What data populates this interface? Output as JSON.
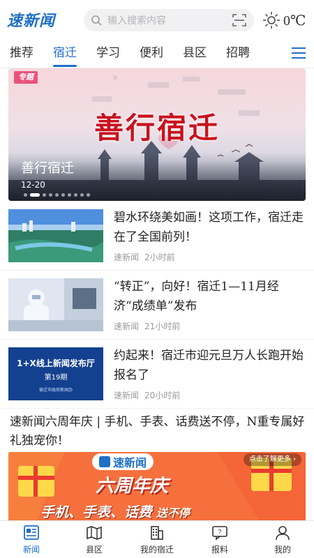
{
  "header": {
    "logo_text": "速新闻",
    "search_placeholder": "输入搜索内容",
    "temperature": "0℃",
    "icons": [
      "search-icon",
      "scan-icon",
      "sun-icon"
    ]
  },
  "tabs": [
    {
      "label": "推荐",
      "active": false
    },
    {
      "label": "宿迁",
      "active": true
    },
    {
      "label": "学习",
      "active": false
    },
    {
      "label": "便利",
      "active": false
    },
    {
      "label": "县区",
      "active": false
    },
    {
      "label": "招聘",
      "active": false
    }
  ],
  "banner": {
    "tag": "专题",
    "headline": "善行宿迁",
    "caption": "善行宿迁",
    "date": "12-20",
    "dots_total": 10,
    "dots_active": 1
  },
  "news": [
    {
      "title": "碧水环绕美如画！这项工作，宿迁走在了全国前列！",
      "source": "速新闻",
      "time": "2小时前"
    },
    {
      "title": "“转正”，向好！宿迁1—11月经济“成绩单”发布",
      "source": "速新闻",
      "time": "21小时前"
    },
    {
      "title": "约起来！宿迁市迎元旦万人长跑开始报名了",
      "source": "速新闻",
      "time": "20小时前",
      "thumb_text": "1+X线上新闻发布厅",
      "thumb_sub": "第19期",
      "thumb_foot": "宿迁市政府新闻办"
    }
  ],
  "feature": {
    "title": "速新闻六周年庆 | 手机、手表、话费送不停，N重专属好礼独宠你！",
    "badge": "点击了解更多",
    "brand": "速新闻",
    "main": "六周年庆",
    "sub": "手机、手表、话费",
    "sub_tail": "送不停"
  },
  "bottom_nav": [
    {
      "label": "新闻",
      "icon": "news-icon",
      "active": true
    },
    {
      "label": "县区",
      "icon": "map-icon",
      "active": false
    },
    {
      "label": "我的宿迁",
      "icon": "building-icon",
      "active": false
    },
    {
      "label": "报料",
      "icon": "report-icon",
      "active": false
    },
    {
      "label": "我的",
      "icon": "profile-icon",
      "active": false
    }
  ],
  "colors": {
    "accent": "#1f6fc6",
    "banner_title": "#c8121e",
    "tag": "#e8537c",
    "feature_bg": "#f5703d"
  }
}
